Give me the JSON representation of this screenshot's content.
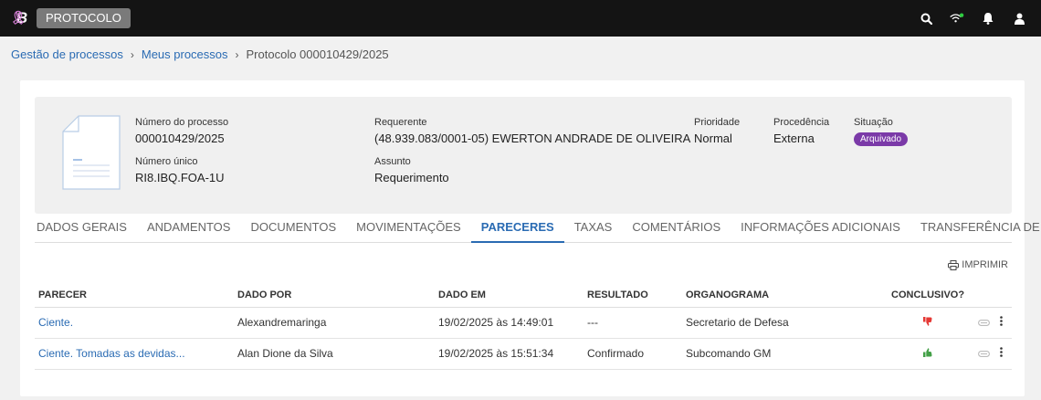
{
  "topbar": {
    "logo_letter": "B",
    "app_name": "PROTOCOLO",
    "icons": [
      "search-icon",
      "wifi-icon",
      "bell-icon",
      "user-icon"
    ],
    "wifi_status_color": "#2ecc40"
  },
  "breadcrumb": {
    "items": [
      "Gestão de processos",
      "Meus processos"
    ],
    "current": "Protocolo 000010429/2025",
    "separator": "›"
  },
  "process": {
    "numero_label": "Número do processo",
    "numero_value": "000010429/2025",
    "unico_label": "Número único",
    "unico_value": "RI8.IBQ.FOA-1U",
    "requerente_label": "Requerente",
    "requerente_value": "(48.939.083/0001-05) EWERTON ANDRADE DE OLIVEIRA",
    "assunto_label": "Assunto",
    "assunto_value": "Requerimento",
    "prioridade_label": "Prioridade",
    "prioridade_value": "Normal",
    "procedencia_label": "Procedência",
    "procedencia_value": "Externa",
    "situacao_label": "Situação",
    "situacao_value": "Arquivado",
    "situacao_color": "#7b3aa8"
  },
  "tabs": [
    {
      "label": "DADOS GERAIS",
      "active": false
    },
    {
      "label": "ANDAMENTOS",
      "active": false
    },
    {
      "label": "DOCUMENTOS",
      "active": false
    },
    {
      "label": "MOVIMENTAÇÕES",
      "active": false
    },
    {
      "label": "PARECERES",
      "active": true
    },
    {
      "label": "TAXAS",
      "active": false
    },
    {
      "label": "COMENTÁRIOS",
      "active": false
    },
    {
      "label": "INFORMAÇÕES ADICIONAIS",
      "active": false
    },
    {
      "label": "TRANSFERÊNCIA DE IMÓVEL",
      "active": false
    }
  ],
  "print_label": "IMPRIMIR",
  "table": {
    "headers": [
      "PARECER",
      "DADO POR",
      "DADO EM",
      "RESULTADO",
      "ORGANOGRAMA",
      "CONCLUSIVO?"
    ],
    "rows": [
      {
        "parecer": "Ciente.",
        "dado_por": "Alexandremaringa",
        "dado_em": "19/02/2025 às 14:49:01",
        "resultado": "---",
        "organograma": "Secretario de Defesa",
        "conclusivo": "thumbs-down-icon",
        "conclusivo_color": "#e53935"
      },
      {
        "parecer": "Ciente. Tomadas as devidas...",
        "dado_por": "Alan Dione da Silva",
        "dado_em": "19/02/2025 às 15:51:34",
        "resultado": "Confirmado",
        "organograma": "Subcomando GM",
        "conclusivo": "thumbs-up-icon",
        "conclusivo_color": "#43a047"
      }
    ]
  }
}
